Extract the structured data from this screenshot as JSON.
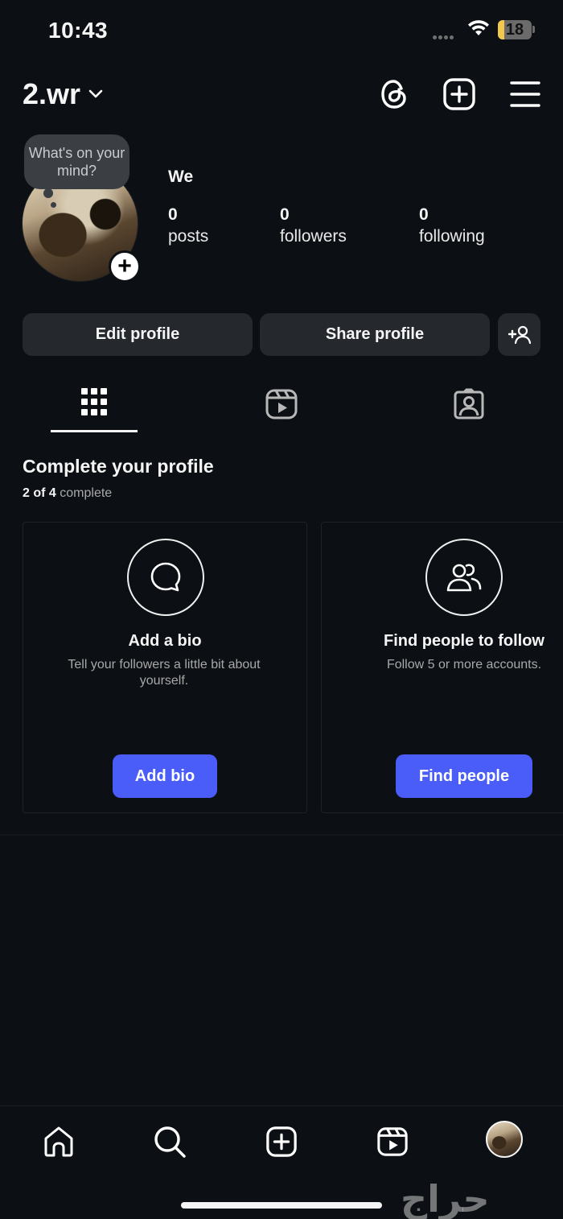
{
  "status_bar": {
    "time": "10:43",
    "battery": "18",
    "battery_color": "#f2c94c"
  },
  "header": {
    "username": "2.wr"
  },
  "note": {
    "placeholder": "What's on your mind?"
  },
  "profile": {
    "display_name": "We",
    "stats": [
      {
        "value": "0",
        "label": "posts"
      },
      {
        "value": "0",
        "label": "followers"
      },
      {
        "value": "0",
        "label": "following"
      }
    ]
  },
  "actions": {
    "edit_label": "Edit profile",
    "share_label": "Share profile"
  },
  "complete_profile": {
    "title": "Complete your profile",
    "done": "2",
    "of_word": "of",
    "total": "4",
    "suffix": "complete",
    "cards": [
      {
        "title": "Add a bio",
        "description": "Tell your followers a little bit about yourself.",
        "button": "Add bio"
      },
      {
        "title": "Find people to follow",
        "description": "Follow 5 or more accounts.",
        "button": "Find people"
      }
    ]
  },
  "colors": {
    "accent": "#4a5df9",
    "background": "#0c1014",
    "button_bg": "#25292e"
  },
  "watermark": "حراج"
}
